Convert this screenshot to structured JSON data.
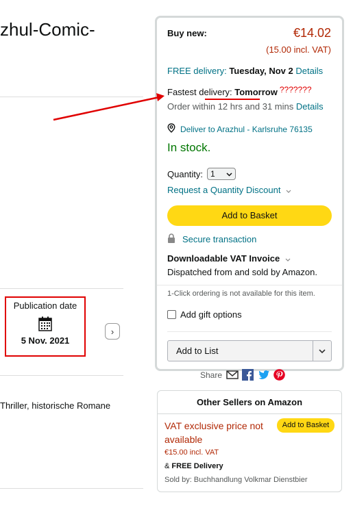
{
  "product": {
    "title_fragment": "zhul-Comic-"
  },
  "details": {
    "publication_label": "Publication date",
    "publication_date": "5 Nov. 2021",
    "next_arrow": "›",
    "genres_fragment": "Thriller, historische Romane"
  },
  "buybox": {
    "buy_new_label": "Buy new:",
    "price": "€14.02",
    "price_incl_vat": "(15.00 incl. VAT)",
    "free_delivery_prefix": "FREE delivery: ",
    "free_delivery_date": "Tuesday, Nov 2",
    "details_link": "Details",
    "fastest_prefix": "Fastest delivery: ",
    "fastest_value": "Tomorrow",
    "fastest_annotation": "???????",
    "order_within": "Order within 12 hrs and 31 mins",
    "order_details_link": "Details",
    "deliver_to": "Deliver to Arazhul - Karlsruhe 76135",
    "stock_status": "In stock.",
    "quantity_label": "Quantity:",
    "quantity_value": "1",
    "quantity_discount": "Request a Quantity Discount",
    "add_to_basket": "Add to Basket",
    "secure_transaction": "Secure transaction",
    "vat_invoice": "Downloadable VAT Invoice",
    "dispatched": "Dispatched from and sold by Amazon.",
    "one_click": "1-Click ordering is not available for this item.",
    "gift_options": "Add gift options",
    "add_to_list": "Add to List"
  },
  "share": {
    "label": "Share"
  },
  "other_sellers": {
    "heading": "Other Sellers on Amazon",
    "vat_note": "VAT exclusive price not available",
    "add_button": "Add to Basket",
    "price_incl_vat": "€15.00 incl. VAT",
    "free_prefix": "& ",
    "free_delivery": "FREE Delivery",
    "sold_by": "Sold by: Buchhandlung Volkmar Dienstbier"
  },
  "colors": {
    "price": "#B12704",
    "link": "#007185",
    "in_stock": "#007600",
    "button_yellow": "#FFD814",
    "annotation_red": "#e00000"
  },
  "icons": [
    "calendar-icon",
    "chevron-right-icon",
    "location-pin-icon",
    "chevron-down-icon",
    "lock-icon",
    "email-icon",
    "facebook-icon",
    "twitter-icon",
    "pinterest-icon"
  ]
}
